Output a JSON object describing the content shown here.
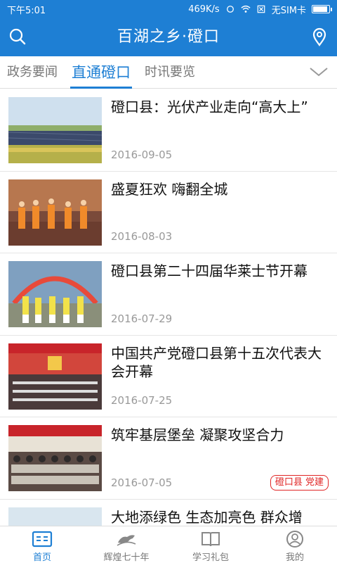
{
  "status_bar": {
    "time": "下午5:01",
    "speed": "469K/s",
    "sim": "无SIM卡"
  },
  "header": {
    "title": "百湖之乡·磴口"
  },
  "tabs": [
    {
      "label": "政务要闻",
      "active": false
    },
    {
      "label": "直通磴口",
      "active": true
    },
    {
      "label": "时讯要览",
      "active": false
    }
  ],
  "news": [
    {
      "title": "磴口县：光伏产业走向“高大上”",
      "date": "2016-09-05"
    },
    {
      "title": "盛夏狂欢 嗨翻全城",
      "date": "2016-08-03"
    },
    {
      "title": "磴口县第二十四届华莱士节开幕",
      "date": "2016-07-29"
    },
    {
      "title": "中国共产党磴口县第十五次代表大会开幕",
      "date": "2016-07-25"
    },
    {
      "title": "筑牢基层堡垒 凝聚攻坚合力",
      "date": "2016-07-05",
      "tag": "磴口县 党建"
    },
    {
      "title": "大地添绿色 生态加亮色 群众增",
      "date": ""
    }
  ],
  "bottom_nav": [
    {
      "label": "首页",
      "icon": "home-news-icon",
      "active": true
    },
    {
      "label": "辉煌七十年",
      "icon": "horse-icon",
      "active": false
    },
    {
      "label": "学习礼包",
      "icon": "book-icon",
      "active": false
    },
    {
      "label": "我的",
      "icon": "user-icon",
      "active": false
    }
  ],
  "colors": {
    "primary": "#1e7fd4",
    "tag_red": "#e02626"
  }
}
